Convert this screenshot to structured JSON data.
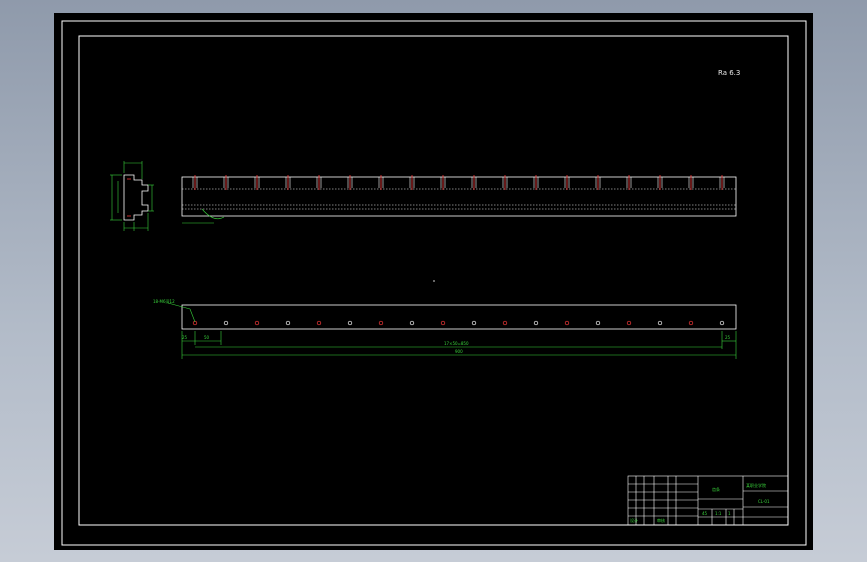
{
  "drawing": {
    "corner_note": "Ra 6.3",
    "leader_label": "18-M6深12",
    "overall_length": "900",
    "pitch_dimension": "17×50=850",
    "end_offset_left": "25",
    "first_pitch": "50",
    "end_offset_right": "25",
    "hole_count": 18
  },
  "title_block": {
    "school": "某职业学院",
    "part_name": "齿条",
    "drawing_no": "CL-01",
    "material": "45",
    "scale": "1:1",
    "sheet": "1",
    "designer": "设计",
    "checker": "审核"
  },
  "colors": {
    "background": "#000000",
    "frame": "#ffffff",
    "dimension": "#39d33b",
    "hole_mark": "#ff3b3b"
  }
}
